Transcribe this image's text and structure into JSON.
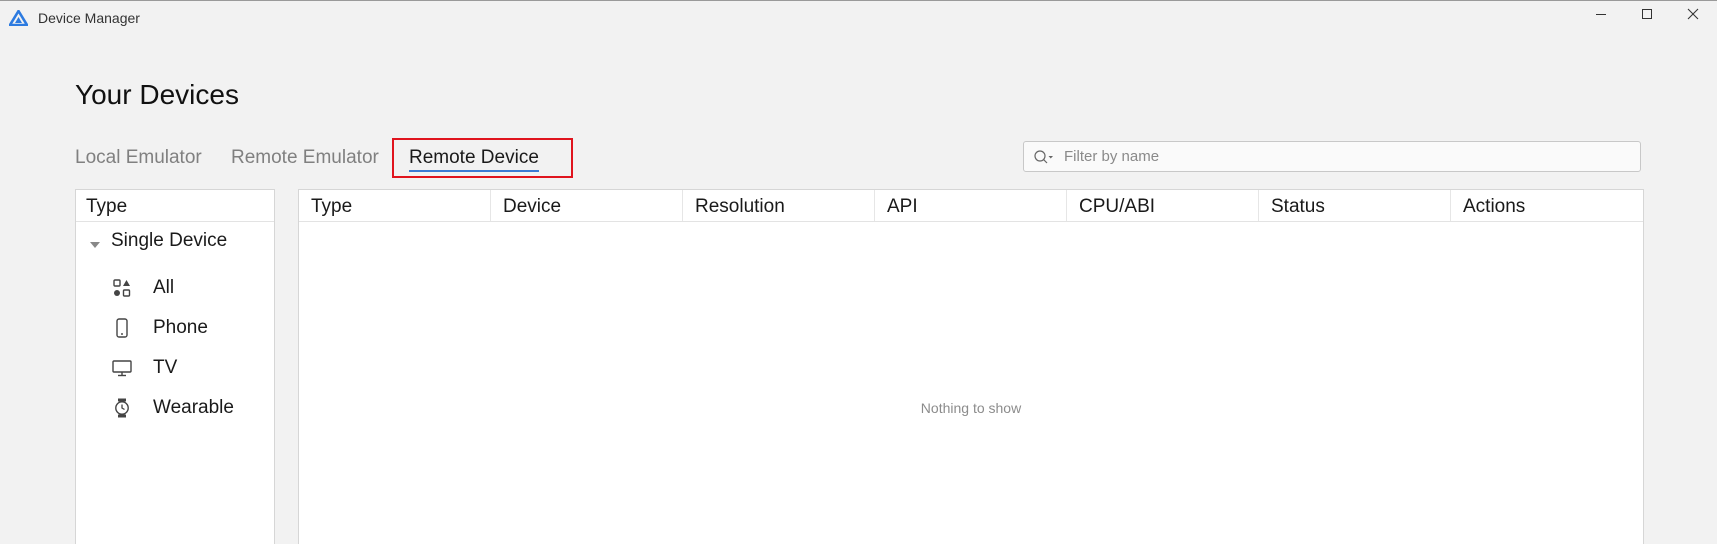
{
  "window": {
    "title": "Device Manager",
    "minimize_icon": "minimize-icon",
    "maximize_icon": "maximize-icon",
    "close_icon": "close-icon"
  },
  "page": {
    "title": "Your Devices"
  },
  "tabs": [
    {
      "label": "Local Emulator",
      "selected": false
    },
    {
      "label": "Remote Emulator",
      "selected": false
    },
    {
      "label": "Remote Device",
      "selected": true
    }
  ],
  "search": {
    "placeholder": "Filter by name",
    "value": ""
  },
  "type_panel": {
    "header": "Type",
    "group": {
      "label": "Single Device",
      "expanded": true,
      "items": [
        {
          "label": "All",
          "icon": "grid-icon"
        },
        {
          "label": "Phone",
          "icon": "phone-icon"
        },
        {
          "label": "TV",
          "icon": "tv-icon"
        },
        {
          "label": "Wearable",
          "icon": "watch-icon"
        }
      ]
    }
  },
  "table": {
    "columns": [
      "Type",
      "Device",
      "Resolution",
      "API",
      "CPU/ABI",
      "Status",
      "Actions"
    ],
    "rows": [],
    "empty_text": "Nothing to show"
  },
  "colors": {
    "background": "#f2f2f2",
    "selected_tab_underline": "#3b7bd4",
    "highlight_box": "#e0141e",
    "logo": "#2d7be0"
  }
}
